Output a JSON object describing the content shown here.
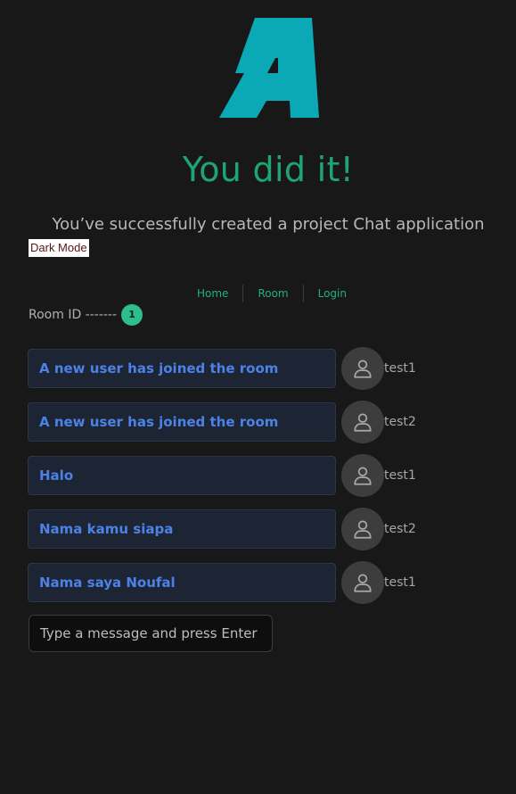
{
  "hero": {
    "headline": "You did it!",
    "subline": "You’ve successfully created a project Chat application"
  },
  "dark_mode_label": "Dark Mode",
  "nav": {
    "items": [
      {
        "label": "Home"
      },
      {
        "label": "Room"
      },
      {
        "label": "Login"
      }
    ]
  },
  "room": {
    "label": "Room ID -------",
    "badge": "1"
  },
  "messages": [
    {
      "text": "A new user has joined the room",
      "user": "test1",
      "icon": "user-icon"
    },
    {
      "text": "A new user has joined the room",
      "user": "test2",
      "icon": "user-icon"
    },
    {
      "text": "Halo",
      "user": "test1",
      "icon": "user-icon"
    },
    {
      "text": "Nama kamu siapa",
      "user": "test2",
      "icon": "user-icon"
    },
    {
      "text": "Nama saya Noufal",
      "user": "test1",
      "icon": "user-icon"
    }
  ],
  "composer": {
    "placeholder": "Type a message and press Enter"
  },
  "colors": {
    "background": "#181818",
    "accent_green": "#1ea574",
    "logo_teal": "#0ba9b5",
    "bubble_text": "#4c82e6"
  }
}
